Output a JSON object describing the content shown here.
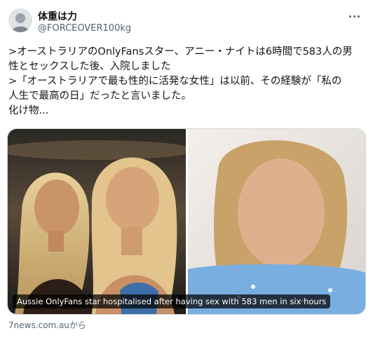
{
  "author": {
    "display_name": "体重は力",
    "handle": "@FORCEOVER100kg"
  },
  "tweet": {
    "lines": [
      ">オーストラリアのOnlyFansスター、アニー・ナイトは6時間で583人の男",
      "性とセックスした後、入院しました",
      ">「オーストラリアで最も性的に活発な女性」は以前、その経験が「私の",
      "人生で最高の日」だったと言いました。",
      "化け物..."
    ]
  },
  "link_card": {
    "caption": "Aussie OnlyFans star hospitalised after having sex with 583 men in six hours",
    "source": "7news.com.auから"
  },
  "icons": {
    "more": "more-horizontal-icon",
    "avatar": "avatar-image"
  }
}
